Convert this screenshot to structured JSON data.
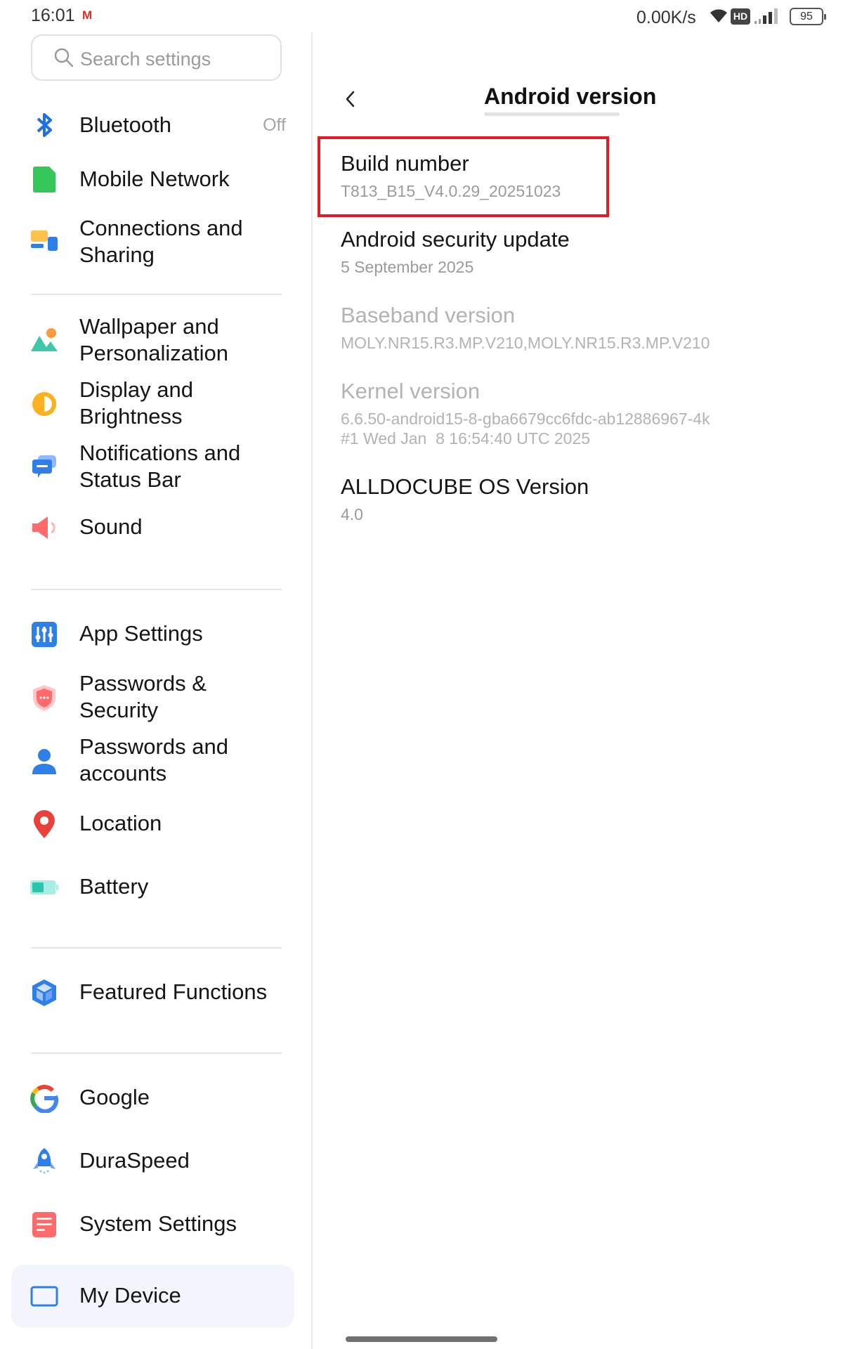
{
  "status_bar": {
    "time": "16:01",
    "notification": "M",
    "net_speed": "0.00K/s",
    "hd_badge": "HD",
    "battery": "95"
  },
  "sidebar": {
    "search_placeholder": "Search settings",
    "items": [
      {
        "label": "Bluetooth",
        "value": "Off",
        "icon": "bluetooth-icon"
      },
      {
        "label": "Mobile Network",
        "icon": "sim-card-icon"
      },
      {
        "label": "Connections and Sharing",
        "icon": "connections-icon"
      },
      {
        "label": "Wallpaper and Personalization",
        "icon": "wallpaper-icon"
      },
      {
        "label": "Display and Brightness",
        "icon": "brightness-icon"
      },
      {
        "label": "Notifications and Status Bar",
        "icon": "notification-icon"
      },
      {
        "label": "Sound",
        "icon": "speaker-icon"
      },
      {
        "label": "App Settings",
        "icon": "app-settings-icon"
      },
      {
        "label": "Passwords & Security",
        "icon": "shield-icon"
      },
      {
        "label": "Passwords and accounts",
        "icon": "account-icon"
      },
      {
        "label": "Location",
        "icon": "location-pin-icon"
      },
      {
        "label": "Battery",
        "icon": "battery-icon"
      },
      {
        "label": "Featured Functions",
        "icon": "cube-icon"
      },
      {
        "label": "Google",
        "icon": "google-icon"
      },
      {
        "label": "DuraSpeed",
        "icon": "rocket-icon"
      },
      {
        "label": "System Settings",
        "icon": "system-settings-icon"
      },
      {
        "label": "My Device",
        "icon": "tablet-icon",
        "selected": true
      }
    ]
  },
  "detail": {
    "title": "Android version",
    "rows": [
      {
        "key": "Build number",
        "value": "T813_B15_V4.0.29_20251023",
        "highlighted": true
      },
      {
        "key": "Android security update",
        "value": "5 September 2025"
      },
      {
        "key": "Baseband version",
        "value": "MOLY.NR15.R3.MP.V210,MOLY.NR15.R3.MP.V210",
        "disabled": true
      },
      {
        "key": "Kernel version",
        "value_line1": "6.6.50-android15-8-gba6679cc6fdc-ab12886967-4k",
        "value_line2": "#1 Wed Jan  8 16:54:40 UTC 2025",
        "disabled": true
      },
      {
        "key": "ALLDOCUBE OS Version",
        "value": "4.0"
      }
    ]
  },
  "colors": {
    "highlight_border": "#e01b24",
    "selected_row_bg": "#f2f5fb"
  }
}
